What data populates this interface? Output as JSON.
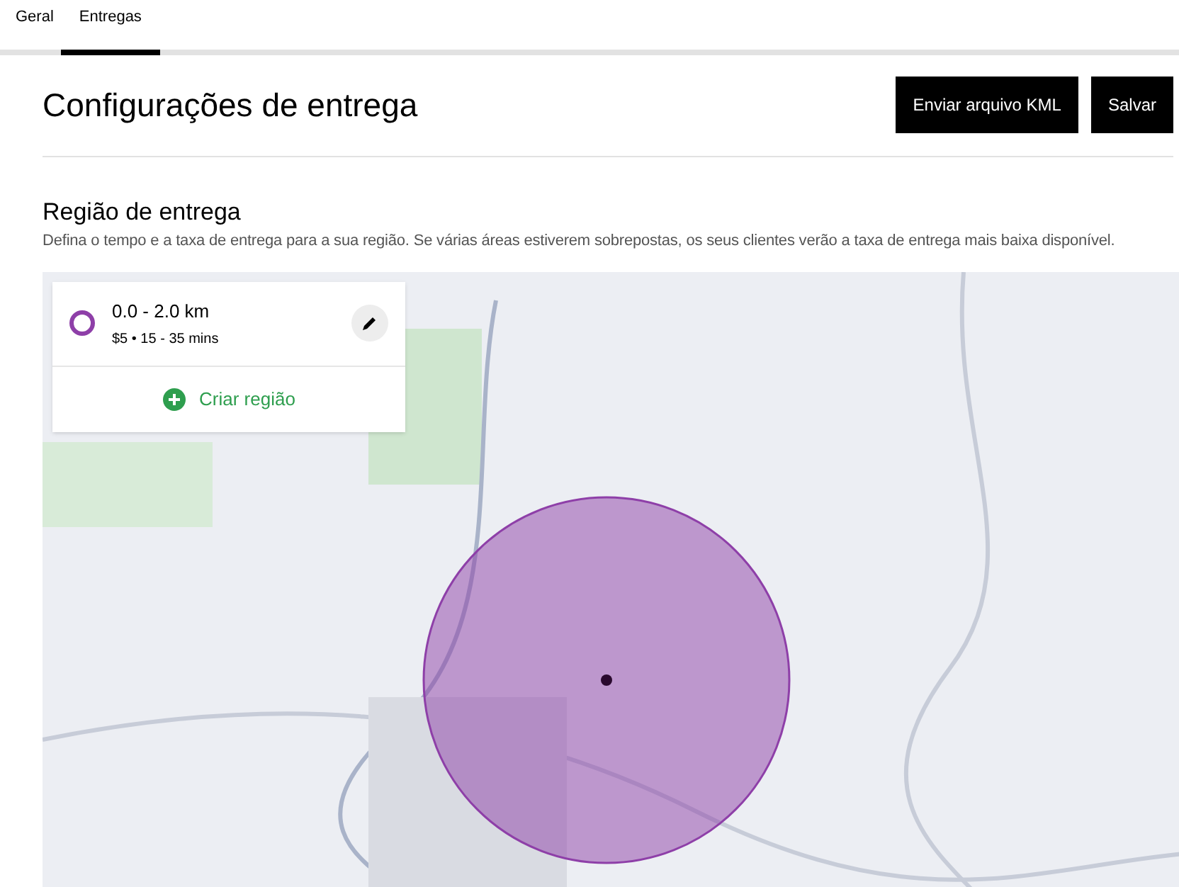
{
  "tabs": [
    {
      "label": "Geral",
      "selected": false
    },
    {
      "label": "Entregas",
      "selected": true
    }
  ],
  "header": {
    "title": "Configurações de entrega",
    "buttons": [
      "Enviar arquivo KML",
      "Salvar"
    ]
  },
  "section": {
    "title": "Região de entrega",
    "description": "Defina o tempo e a taxa de entrega para a sua região. Se várias áreas estiverem sobrepostas, os seus clientes verão a taxa de entrega mais baixa disponível."
  },
  "regions": [
    {
      "name": "0.0 - 2.0 km",
      "details": "$5 • 15 - 35 mins",
      "color": "#8e3fa8"
    }
  ],
  "create_region": "Criar região"
}
